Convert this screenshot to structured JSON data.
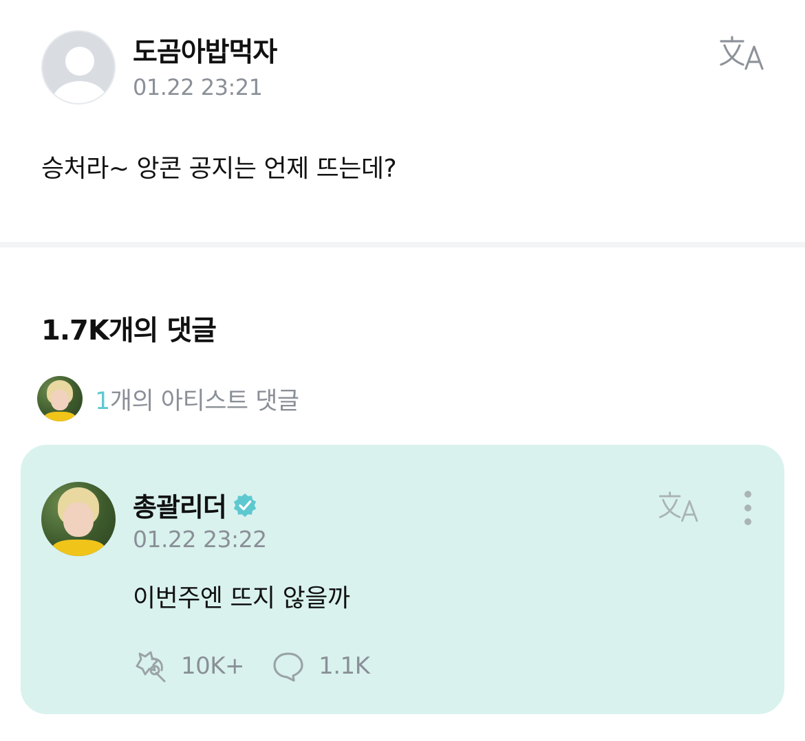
{
  "post": {
    "author": "도곰아밥먹자",
    "time": "01.22 23:21",
    "body": "승처라~ 앙콘 공지는 언제 뜨는데?"
  },
  "comments": {
    "count_label": "1.7K개의 댓글",
    "artist_count_num": "1",
    "artist_count_suffix": "개의 아티스트 댓글"
  },
  "artist_comment": {
    "author": "총괄리더",
    "time": "01.22 23:22",
    "body": "이번주엔 뜨지 않을까",
    "likes": "10K+",
    "replies": "1.1K"
  },
  "colors": {
    "accent": "#5ec8d0",
    "card_background": "#d9f2ee",
    "muted_text": "#8a8f97"
  },
  "icons": [
    "default-avatar-icon",
    "translate-icon",
    "verified-badge-icon",
    "more-vertical-icon",
    "cheer-icon",
    "comment-bubble-icon"
  ]
}
